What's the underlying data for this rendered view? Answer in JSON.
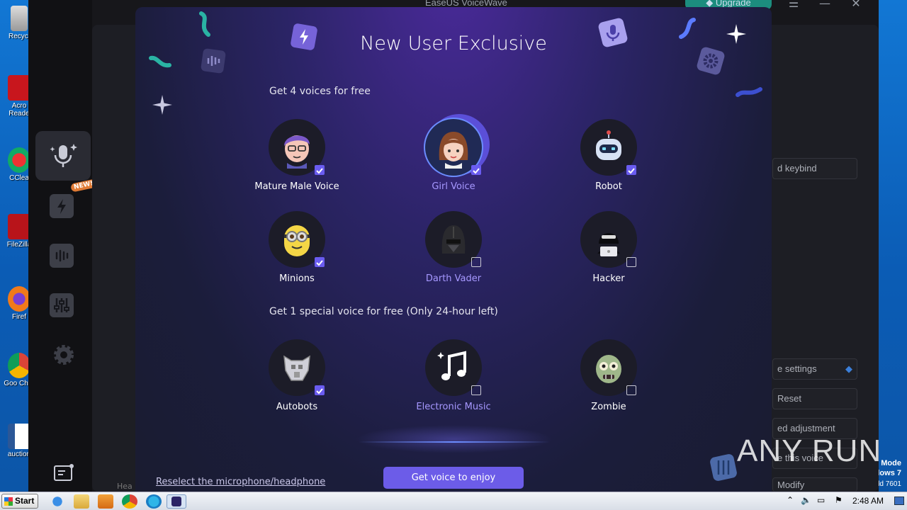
{
  "desktop": {
    "icons": [
      {
        "label": "Recycl",
        "name": "recycle-bin"
      },
      {
        "label": "Acro Reade",
        "name": "acrobat-reader"
      },
      {
        "label": "CClea",
        "name": "ccleaner"
      },
      {
        "label": "FileZilla",
        "name": "filezilla"
      },
      {
        "label": "Firef",
        "name": "firefox"
      },
      {
        "label": "Goo Chro",
        "name": "google-chrome"
      },
      {
        "label": "auction",
        "name": "word-document"
      }
    ],
    "edge_text": {
      "line1": "Mode",
      "line2": "lows 7",
      "line3": "ld 7601"
    },
    "watermark": "ANY RUN"
  },
  "app": {
    "title": "EaseUS VoiceWave",
    "upgrade_label": "Upgrade",
    "window_controls": {
      "menu": "☰",
      "minimize": "—",
      "close": "✕"
    },
    "sidebar": {
      "new_badge": "NEW!",
      "items": [
        "microphone-sparkle-icon",
        "lightning-icon",
        "soundboard-icon",
        "mixer-icon",
        "gear-icon",
        "feedback-book-icon"
      ]
    },
    "right_panel": {
      "keybind": "d keybind",
      "more_settings": "e settings",
      "reset": "Reset",
      "advanced": "ed adjustment",
      "save_voice": "e this voice",
      "modify": "Modify",
      "bottom_left": "Hea"
    }
  },
  "modal": {
    "title": "New User Exclusive",
    "section1_label": "Get 4 voices for free",
    "section2_label": "Get 1 special voice for free (Only 24-hour left)",
    "voices": [
      {
        "label": "Mature Male Voice",
        "checked": true,
        "highlight": false
      },
      {
        "label": "Girl Voice",
        "checked": true,
        "highlight": true
      },
      {
        "label": "Robot",
        "checked": true,
        "highlight": false
      },
      {
        "label": "Minions",
        "checked": true,
        "highlight": false
      },
      {
        "label": "Darth Vader",
        "checked": false,
        "highlight": true
      },
      {
        "label": "Hacker",
        "checked": false,
        "highlight": false
      }
    ],
    "special_voices": [
      {
        "label": "Autobots",
        "checked": true,
        "highlight": false
      },
      {
        "label": "Electronic Music",
        "checked": false,
        "highlight": true
      },
      {
        "label": "Zombie",
        "checked": false,
        "highlight": false
      }
    ],
    "cta_label": "Get voice to enjoy",
    "reselect_label": "Reselect the microphone/headphone",
    "accent_color": "#6c5ce8"
  },
  "taskbar": {
    "start_label": "Start",
    "clock": "2:48 AM",
    "apps": [
      "internet-explorer",
      "file-explorer",
      "media-player",
      "chrome",
      "edge",
      "voicewave"
    ]
  }
}
